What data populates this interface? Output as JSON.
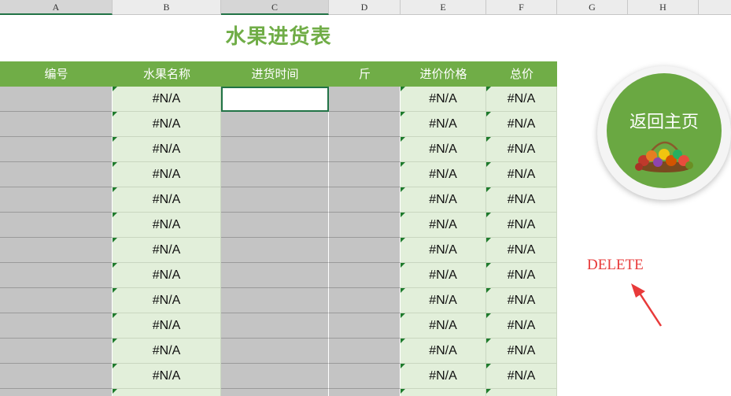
{
  "column_headers": [
    "A",
    "B",
    "C",
    "D",
    "E",
    "F",
    "G",
    "H"
  ],
  "title": "水果进货表",
  "table": {
    "headers": [
      "编号",
      "水果名称",
      "进货时间",
      "斤",
      "进价价格",
      "总价"
    ],
    "rows": [
      {
        "id": "",
        "name": "#N/A",
        "date": "",
        "jin": "",
        "price": "#N/A",
        "total": "#N/A"
      },
      {
        "id": "",
        "name": "#N/A",
        "date": "",
        "jin": "",
        "price": "#N/A",
        "total": "#N/A"
      },
      {
        "id": "",
        "name": "#N/A",
        "date": "",
        "jin": "",
        "price": "#N/A",
        "total": "#N/A"
      },
      {
        "id": "",
        "name": "#N/A",
        "date": "",
        "jin": "",
        "price": "#N/A",
        "total": "#N/A"
      },
      {
        "id": "",
        "name": "#N/A",
        "date": "",
        "jin": "",
        "price": "#N/A",
        "total": "#N/A"
      },
      {
        "id": "",
        "name": "#N/A",
        "date": "",
        "jin": "",
        "price": "#N/A",
        "total": "#N/A"
      },
      {
        "id": "",
        "name": "#N/A",
        "date": "",
        "jin": "",
        "price": "#N/A",
        "total": "#N/A"
      },
      {
        "id": "",
        "name": "#N/A",
        "date": "",
        "jin": "",
        "price": "#N/A",
        "total": "#N/A"
      },
      {
        "id": "",
        "name": "#N/A",
        "date": "",
        "jin": "",
        "price": "#N/A",
        "total": "#N/A"
      },
      {
        "id": "",
        "name": "#N/A",
        "date": "",
        "jin": "",
        "price": "#N/A",
        "total": "#N/A"
      },
      {
        "id": "",
        "name": "#N/A",
        "date": "",
        "jin": "",
        "price": "#N/A",
        "total": "#N/A"
      },
      {
        "id": "",
        "name": "#N/A",
        "date": "",
        "jin": "",
        "price": "#N/A",
        "total": "#N/A"
      }
    ]
  },
  "home_button": {
    "label": "返回主页",
    "icon": "fruit-basket-icon"
  },
  "annotation": {
    "text": "DELETE",
    "icon": "arrow-icon",
    "color": "#e83a3a"
  },
  "colors": {
    "accent": "#70ad47",
    "input_cell": "#e2efda",
    "locked_cell": "#c4c4c4"
  }
}
